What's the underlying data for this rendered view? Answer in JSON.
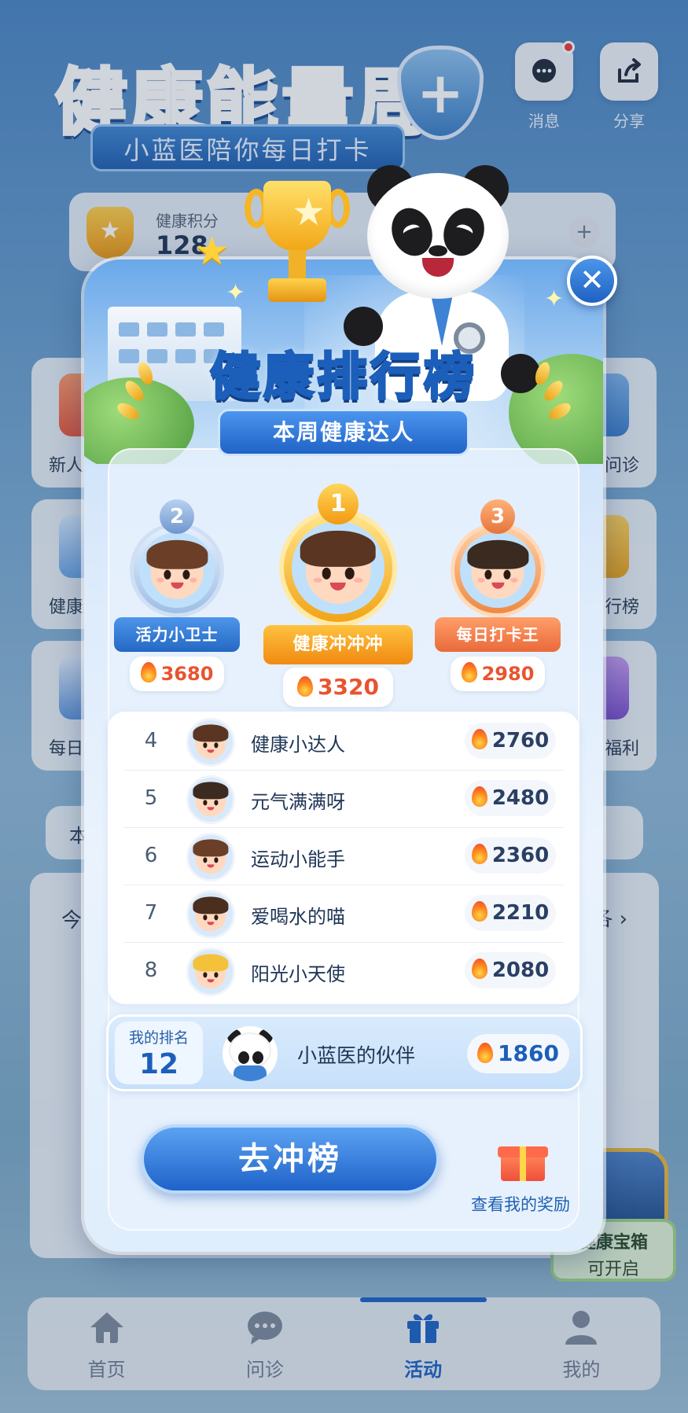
{
  "background": {
    "title": "健康能量周",
    "subtitle": "小蓝医陪你每日打卡",
    "top_buttons": [
      {
        "label": "消息",
        "icon": "message-icon",
        "has_badge": true
      },
      {
        "label": "分享",
        "icon": "share-icon"
      }
    ],
    "points_card": {
      "label": "健康积分",
      "value": "128"
    },
    "tiles": [
      {
        "label": "新人",
        "side": "left"
      },
      {
        "label": "问诊",
        "side": "right"
      },
      {
        "label": "健康",
        "side": "left"
      },
      {
        "label": "行榜",
        "side": "right"
      },
      {
        "label": "每日",
        "side": "left"
      },
      {
        "label": "福利",
        "side": "right"
      }
    ],
    "strip_label": "本",
    "panel_label": "今",
    "panel_more": "各 ›",
    "treasure": {
      "title": "健康宝箱",
      "status": "可开启"
    }
  },
  "bottom_nav": {
    "items": [
      {
        "label": "首页",
        "icon": "home-icon",
        "active": false
      },
      {
        "label": "问诊",
        "icon": "chat-icon",
        "active": false
      },
      {
        "label": "活动",
        "icon": "gift-icon",
        "active": true
      },
      {
        "label": "我的",
        "icon": "user-icon",
        "active": false
      }
    ]
  },
  "modal": {
    "title": "健康排行榜",
    "subtitle": "本周健康达人",
    "close_icon": "close-icon",
    "podium": [
      {
        "rank": "2",
        "name": "活力小卫士",
        "score": "3680",
        "color": "#8fb4e6"
      },
      {
        "rank": "1",
        "name": "健康冲冲冲",
        "score": "3320",
        "color": "#f6b324"
      },
      {
        "rank": "3",
        "name": "每日打卡王",
        "score": "2980",
        "color": "#f08a4b"
      }
    ],
    "list": [
      {
        "rank": "4",
        "name": "健康小达人",
        "score": "2760"
      },
      {
        "rank": "5",
        "name": "元气满满呀",
        "score": "2480"
      },
      {
        "rank": "6",
        "name": "运动小能手",
        "score": "2360"
      },
      {
        "rank": "7",
        "name": "爱喝水的喵",
        "score": "2210"
      },
      {
        "rank": "8",
        "name": "阳光小天使",
        "score": "2080"
      }
    ],
    "my_rank": {
      "label": "我的排名",
      "value": "12",
      "name": "小蓝医的伙伴",
      "score": "1860"
    },
    "cta_label": "去冲榜",
    "reward_label": "查看我的奖励"
  },
  "colors": {
    "primary": "#1c63c5",
    "flame": "#f0432b",
    "gold": "#f6b324"
  }
}
